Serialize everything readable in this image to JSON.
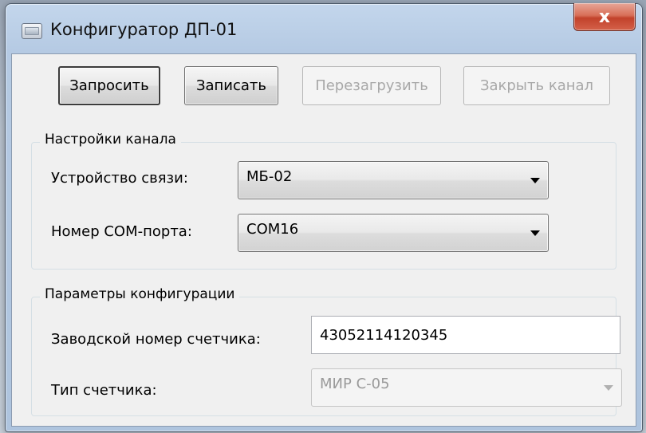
{
  "window": {
    "title": "Конфигуратор ДП-01",
    "close_label": "x"
  },
  "toolbar": {
    "request_label": "Запросить",
    "write_label": "Записать",
    "reboot_label": "Перезагрузить",
    "close_channel_label": "Закрыть канал"
  },
  "channel_settings": {
    "legend": "Настройки канала",
    "device_label": "Устройство связи:",
    "device_value": "МБ-02",
    "port_label": "Номер COM-порта:",
    "port_value": "COM16"
  },
  "config_params": {
    "legend": "Параметры конфигурации",
    "serial_label": "Заводской номер счетчика:",
    "serial_value": "43052114120345",
    "meter_type_label": "Тип счетчика:",
    "meter_type_value": "МИР С-05"
  },
  "colors": {
    "close_button": "#c8452e",
    "client_background": "#f0f0f0",
    "disabled_text": "#a8a8a8"
  }
}
